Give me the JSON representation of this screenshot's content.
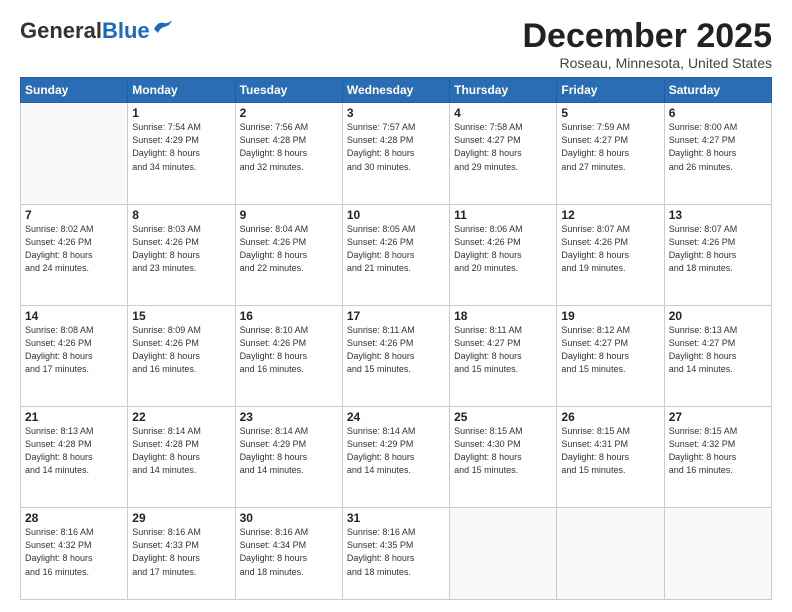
{
  "header": {
    "logo_general": "General",
    "logo_blue": "Blue",
    "month_title": "December 2025",
    "location": "Roseau, Minnesota, United States"
  },
  "calendar": {
    "days_of_week": [
      "Sunday",
      "Monday",
      "Tuesday",
      "Wednesday",
      "Thursday",
      "Friday",
      "Saturday"
    ],
    "weeks": [
      [
        {
          "day": "",
          "info": ""
        },
        {
          "day": "1",
          "info": "Sunrise: 7:54 AM\nSunset: 4:29 PM\nDaylight: 8 hours\nand 34 minutes."
        },
        {
          "day": "2",
          "info": "Sunrise: 7:56 AM\nSunset: 4:28 PM\nDaylight: 8 hours\nand 32 minutes."
        },
        {
          "day": "3",
          "info": "Sunrise: 7:57 AM\nSunset: 4:28 PM\nDaylight: 8 hours\nand 30 minutes."
        },
        {
          "day": "4",
          "info": "Sunrise: 7:58 AM\nSunset: 4:27 PM\nDaylight: 8 hours\nand 29 minutes."
        },
        {
          "day": "5",
          "info": "Sunrise: 7:59 AM\nSunset: 4:27 PM\nDaylight: 8 hours\nand 27 minutes."
        },
        {
          "day": "6",
          "info": "Sunrise: 8:00 AM\nSunset: 4:27 PM\nDaylight: 8 hours\nand 26 minutes."
        }
      ],
      [
        {
          "day": "7",
          "info": "Sunrise: 8:02 AM\nSunset: 4:26 PM\nDaylight: 8 hours\nand 24 minutes."
        },
        {
          "day": "8",
          "info": "Sunrise: 8:03 AM\nSunset: 4:26 PM\nDaylight: 8 hours\nand 23 minutes."
        },
        {
          "day": "9",
          "info": "Sunrise: 8:04 AM\nSunset: 4:26 PM\nDaylight: 8 hours\nand 22 minutes."
        },
        {
          "day": "10",
          "info": "Sunrise: 8:05 AM\nSunset: 4:26 PM\nDaylight: 8 hours\nand 21 minutes."
        },
        {
          "day": "11",
          "info": "Sunrise: 8:06 AM\nSunset: 4:26 PM\nDaylight: 8 hours\nand 20 minutes."
        },
        {
          "day": "12",
          "info": "Sunrise: 8:07 AM\nSunset: 4:26 PM\nDaylight: 8 hours\nand 19 minutes."
        },
        {
          "day": "13",
          "info": "Sunrise: 8:07 AM\nSunset: 4:26 PM\nDaylight: 8 hours\nand 18 minutes."
        }
      ],
      [
        {
          "day": "14",
          "info": "Sunrise: 8:08 AM\nSunset: 4:26 PM\nDaylight: 8 hours\nand 17 minutes."
        },
        {
          "day": "15",
          "info": "Sunrise: 8:09 AM\nSunset: 4:26 PM\nDaylight: 8 hours\nand 16 minutes."
        },
        {
          "day": "16",
          "info": "Sunrise: 8:10 AM\nSunset: 4:26 PM\nDaylight: 8 hours\nand 16 minutes."
        },
        {
          "day": "17",
          "info": "Sunrise: 8:11 AM\nSunset: 4:26 PM\nDaylight: 8 hours\nand 15 minutes."
        },
        {
          "day": "18",
          "info": "Sunrise: 8:11 AM\nSunset: 4:27 PM\nDaylight: 8 hours\nand 15 minutes."
        },
        {
          "day": "19",
          "info": "Sunrise: 8:12 AM\nSunset: 4:27 PM\nDaylight: 8 hours\nand 15 minutes."
        },
        {
          "day": "20",
          "info": "Sunrise: 8:13 AM\nSunset: 4:27 PM\nDaylight: 8 hours\nand 14 minutes."
        }
      ],
      [
        {
          "day": "21",
          "info": "Sunrise: 8:13 AM\nSunset: 4:28 PM\nDaylight: 8 hours\nand 14 minutes."
        },
        {
          "day": "22",
          "info": "Sunrise: 8:14 AM\nSunset: 4:28 PM\nDaylight: 8 hours\nand 14 minutes."
        },
        {
          "day": "23",
          "info": "Sunrise: 8:14 AM\nSunset: 4:29 PM\nDaylight: 8 hours\nand 14 minutes."
        },
        {
          "day": "24",
          "info": "Sunrise: 8:14 AM\nSunset: 4:29 PM\nDaylight: 8 hours\nand 14 minutes."
        },
        {
          "day": "25",
          "info": "Sunrise: 8:15 AM\nSunset: 4:30 PM\nDaylight: 8 hours\nand 15 minutes."
        },
        {
          "day": "26",
          "info": "Sunrise: 8:15 AM\nSunset: 4:31 PM\nDaylight: 8 hours\nand 15 minutes."
        },
        {
          "day": "27",
          "info": "Sunrise: 8:15 AM\nSunset: 4:32 PM\nDaylight: 8 hours\nand 16 minutes."
        }
      ],
      [
        {
          "day": "28",
          "info": "Sunrise: 8:16 AM\nSunset: 4:32 PM\nDaylight: 8 hours\nand 16 minutes."
        },
        {
          "day": "29",
          "info": "Sunrise: 8:16 AM\nSunset: 4:33 PM\nDaylight: 8 hours\nand 17 minutes."
        },
        {
          "day": "30",
          "info": "Sunrise: 8:16 AM\nSunset: 4:34 PM\nDaylight: 8 hours\nand 18 minutes."
        },
        {
          "day": "31",
          "info": "Sunrise: 8:16 AM\nSunset: 4:35 PM\nDaylight: 8 hours\nand 18 minutes."
        },
        {
          "day": "",
          "info": ""
        },
        {
          "day": "",
          "info": ""
        },
        {
          "day": "",
          "info": ""
        }
      ]
    ]
  }
}
